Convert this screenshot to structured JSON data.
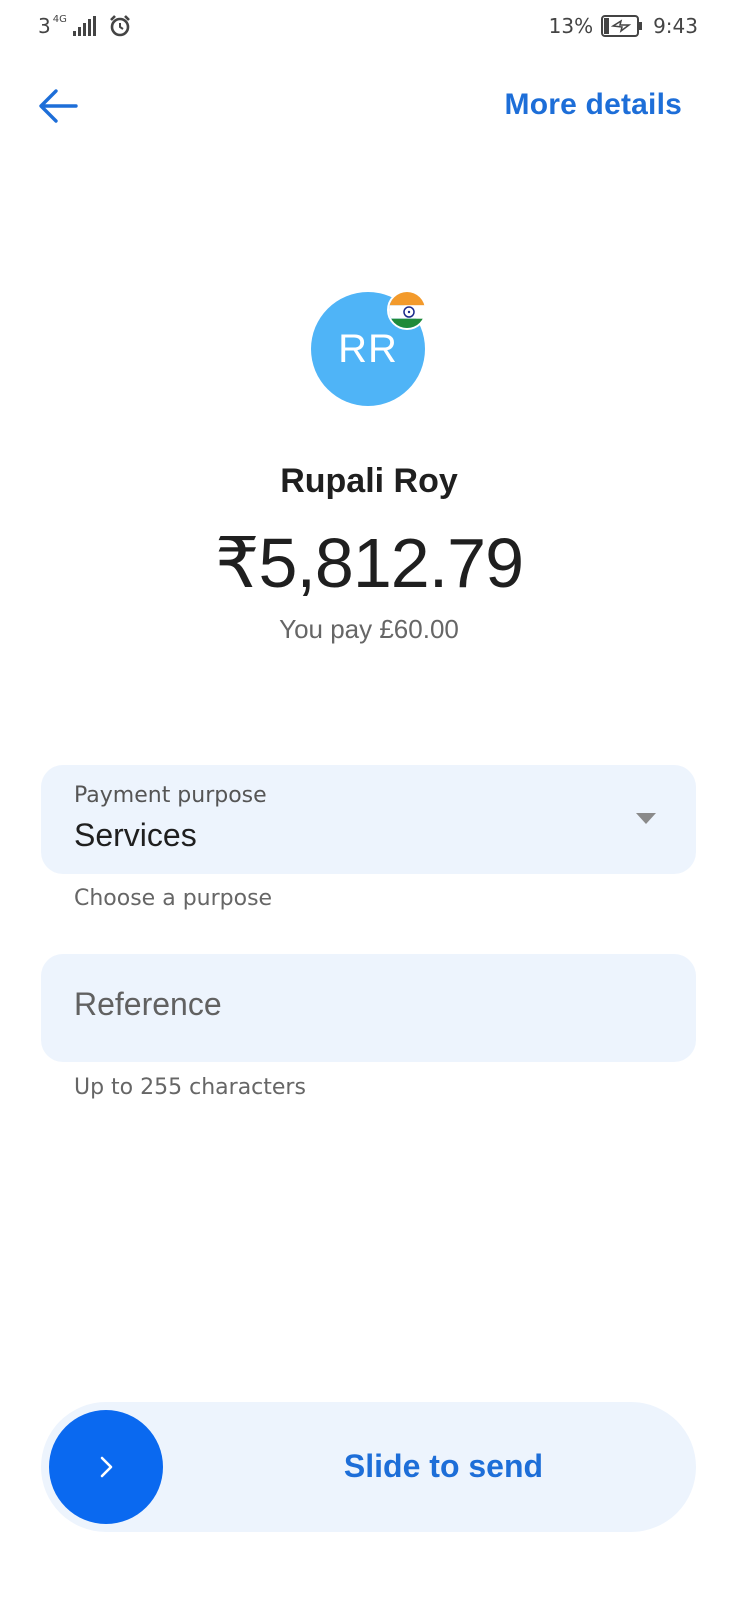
{
  "status_bar": {
    "sim": "3",
    "network": "4G",
    "battery": "13%",
    "time": "9:43"
  },
  "header": {
    "back_icon": "arrow-left-icon",
    "more_details": "More details"
  },
  "recipient": {
    "initials": "RR",
    "flag_icon": "india-flag-icon",
    "avatar_color": "#4fb4f7",
    "name": "Rupali Roy",
    "amount": "₹5,812.79",
    "you_pay": "You pay £60.00"
  },
  "purpose": {
    "label": "Payment purpose",
    "value": "Services",
    "helper": "Choose a purpose"
  },
  "reference": {
    "placeholder": "Reference",
    "helper": "Up to 255 characters"
  },
  "send": {
    "label": "Slide to send",
    "knob_icon": "chevron-right-icon",
    "accent": "#0a69f0"
  }
}
